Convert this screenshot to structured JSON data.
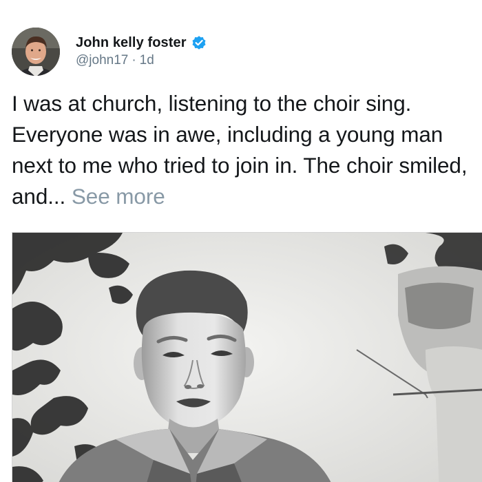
{
  "tweet": {
    "author": {
      "display_name": "John kelly foster",
      "handle": "@john17",
      "verified": true,
      "avatar_icon": "avatar-photo"
    },
    "timestamp": "1d",
    "separator": "·",
    "text": "I was at church, listening to the choir sing. Everyone was in awe, including a young man next to me who tried to join in. The choir smiled, and... ",
    "see_more_label": "See more",
    "media": {
      "icon": "photo-icon",
      "description_style": "black-and-white vintage portrait photo"
    }
  },
  "colors": {
    "name_text": "#14171a",
    "secondary_text": "#657786",
    "see_more": "#8899a6",
    "verified_badge": "#1da1f2",
    "background": "#ffffff"
  }
}
